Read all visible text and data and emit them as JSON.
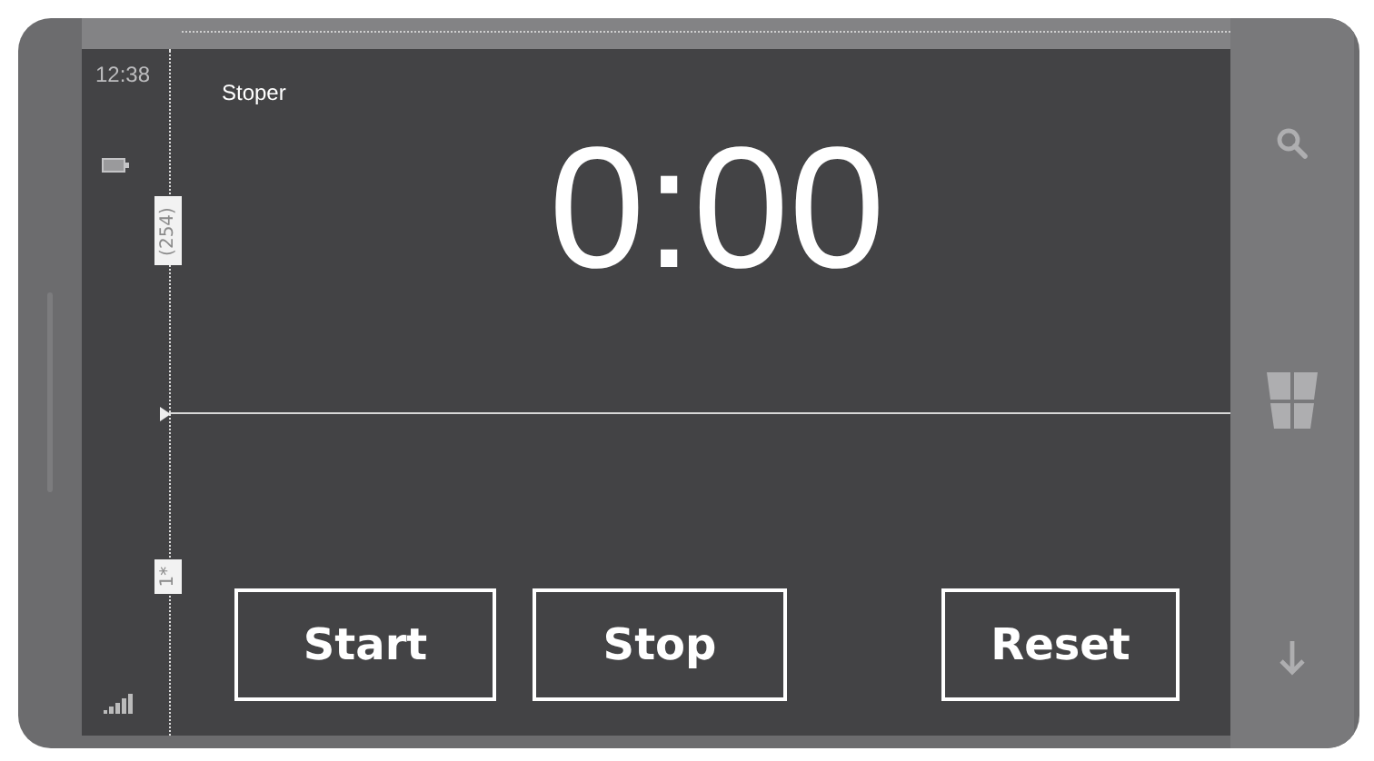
{
  "status_bar": {
    "time": "12:38"
  },
  "app": {
    "title": "Stoper",
    "time_display": "0:00"
  },
  "design_markers": {
    "row_height": "(254)",
    "star_height": "1*"
  },
  "buttons": [
    {
      "label": "Start"
    },
    {
      "label": "Stop"
    },
    {
      "label": "Reset"
    }
  ]
}
